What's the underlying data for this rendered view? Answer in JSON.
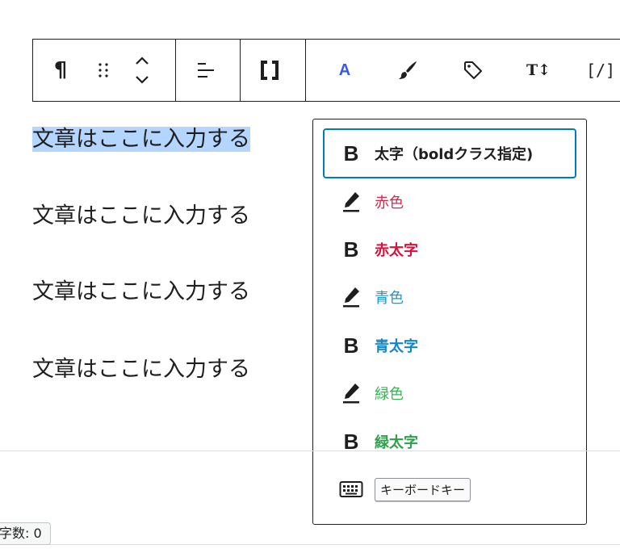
{
  "toolbar": {
    "paragraph_icon": "¶",
    "drag_handle_icon": "drag-handle-icon",
    "move_icon": "chevron-up-down-icon",
    "align_icon": "align-left-icon",
    "bracket_icon": "bracket-icon",
    "highlight_label": "A",
    "brush_icon": "brush-icon",
    "tag_icon": "tag-icon",
    "font_size_label": "T↕",
    "code_label": "[/]"
  },
  "paragraphs": [
    "文章はここに入力する",
    "文章はここに入力する",
    "文章はここに入力する",
    "文章はここに入力する"
  ],
  "dropdown": {
    "items": [
      {
        "label": "太字（boldクラス指定)",
        "icon": "bold-icon",
        "color": "#1e1e1e",
        "bold": true
      },
      {
        "label": "赤色",
        "icon": "pen-icon",
        "color": "#d6264d",
        "bold": false
      },
      {
        "label": "赤太字",
        "icon": "bold-icon",
        "color": "#d6113a",
        "bold": true
      },
      {
        "label": "青色",
        "icon": "pen-icon",
        "color": "#1f96d3",
        "bold": false
      },
      {
        "label": "青太字",
        "icon": "bold-icon",
        "color": "#1287c8",
        "bold": true
      },
      {
        "label": "緑色",
        "icon": "pen-icon",
        "color": "#3fae5a",
        "bold": false
      },
      {
        "label": "緑太字",
        "icon": "bold-icon",
        "color": "#2ea04c",
        "bold": true
      }
    ],
    "keyboard": {
      "icon": "keyboard-icon",
      "label": "キーボードキー"
    }
  },
  "footer": {
    "char_count": "字数: 0"
  },
  "colors": {
    "accent": "#007cba",
    "selection": "#b4d5fe"
  }
}
